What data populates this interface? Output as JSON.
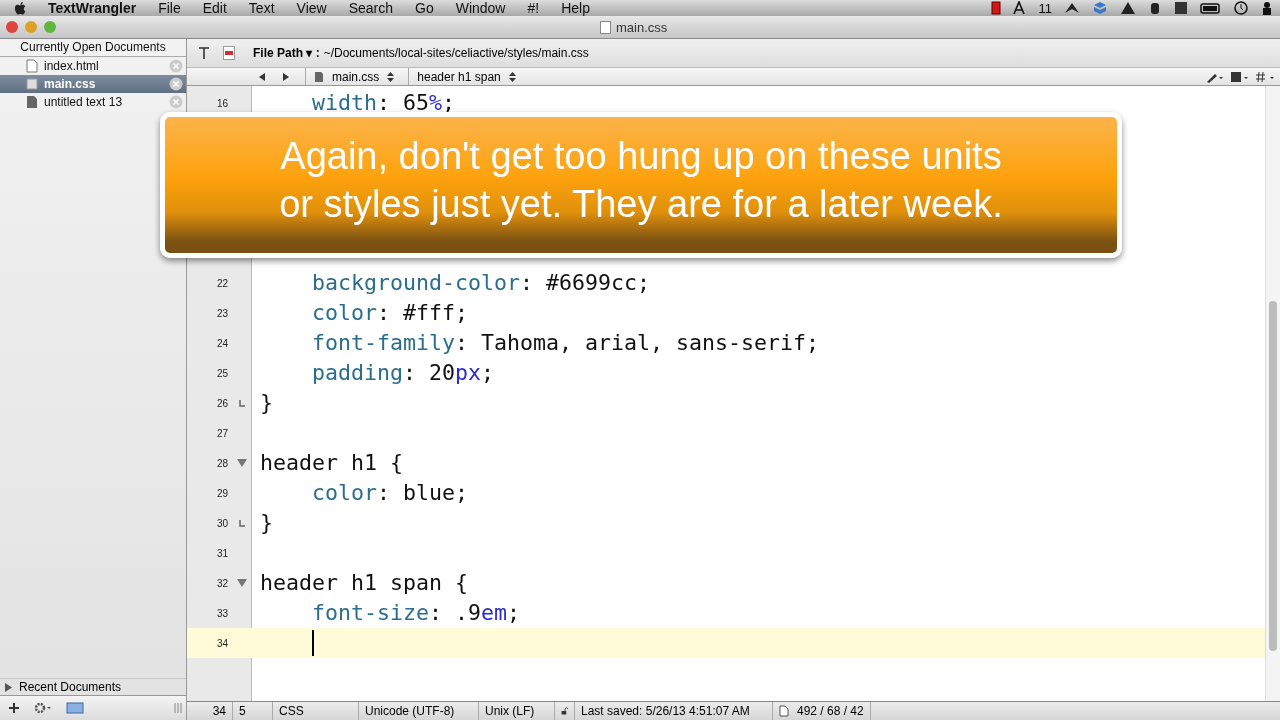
{
  "menu_bar": {
    "app_name": "TextWrangler",
    "items": [
      "File",
      "Edit",
      "Text",
      "View",
      "Search",
      "Go",
      "Window",
      "#!",
      "Help"
    ],
    "status_text": "11"
  },
  "window": {
    "title": "main.css"
  },
  "sidebar": {
    "header": "Currently Open Documents",
    "documents": [
      {
        "name": "index.html",
        "selected": false,
        "kind": "html"
      },
      {
        "name": "main.css",
        "selected": true,
        "kind": "css"
      },
      {
        "name": "untitled text 13",
        "selected": false,
        "kind": "text"
      }
    ],
    "recent": {
      "label": "Recent Documents",
      "expanded": false
    }
  },
  "toolbar": {
    "path_label": "File Path ▾ :",
    "path": "~/Documents/local-sites/celiactive/styles/main.css"
  },
  "navigation": {
    "document": "main.css",
    "symbol": "header h1 span"
  },
  "editor": {
    "lines": [
      {
        "number": "16",
        "fold_start": false,
        "fold_end": false,
        "indented": true,
        "current": false,
        "tokens": [
          {
            "kind": "prop",
            "text": "width"
          },
          {
            "kind": "plain",
            "text": ": 65"
          },
          {
            "kind": "unit",
            "text": "%"
          },
          {
            "kind": "plain",
            "text": ";"
          }
        ]
      },
      {
        "number": "22",
        "fold_start": false,
        "fold_end": false,
        "indented": true,
        "current": false,
        "tokens": [
          {
            "kind": "prop",
            "text": "background-color"
          },
          {
            "kind": "plain",
            "text": ": #6699cc;"
          }
        ]
      },
      {
        "number": "23",
        "fold_start": false,
        "fold_end": false,
        "indented": true,
        "current": false,
        "tokens": [
          {
            "kind": "prop",
            "text": "color"
          },
          {
            "kind": "plain",
            "text": ": #fff;"
          }
        ]
      },
      {
        "number": "24",
        "fold_start": false,
        "fold_end": false,
        "indented": true,
        "current": false,
        "tokens": [
          {
            "kind": "prop",
            "text": "font-family"
          },
          {
            "kind": "plain",
            "text": ": Tahoma, arial, sans-serif;"
          }
        ]
      },
      {
        "number": "25",
        "fold_start": false,
        "fold_end": false,
        "indented": true,
        "current": false,
        "tokens": [
          {
            "kind": "prop",
            "text": "padding"
          },
          {
            "kind": "plain",
            "text": ": 20"
          },
          {
            "kind": "unit",
            "text": "px"
          },
          {
            "kind": "plain",
            "text": ";"
          }
        ]
      },
      {
        "number": "26",
        "fold_start": false,
        "fold_end": true,
        "indented": false,
        "current": false,
        "tokens": [
          {
            "kind": "plain",
            "text": "}"
          }
        ]
      },
      {
        "number": "27",
        "fold_start": false,
        "fold_end": false,
        "current": false
      },
      {
        "number": "28",
        "fold_start": true,
        "fold_end": false,
        "indented": false,
        "current": false,
        "tokens": [
          {
            "kind": "plain",
            "text": "header h1 {"
          }
        ]
      },
      {
        "number": "29",
        "fold_start": false,
        "fold_end": false,
        "indented": true,
        "current": false,
        "tokens": [
          {
            "kind": "prop",
            "text": "color"
          },
          {
            "kind": "plain",
            "text": ": blue;"
          }
        ]
      },
      {
        "number": "30",
        "fold_start": false,
        "fold_end": true,
        "indented": false,
        "current": false,
        "tokens": [
          {
            "kind": "plain",
            "text": "}"
          }
        ]
      },
      {
        "number": "31",
        "fold_start": false,
        "fold_end": false,
        "current": false
      },
      {
        "number": "32",
        "fold_start": true,
        "fold_end": false,
        "indented": false,
        "current": false,
        "tokens": [
          {
            "kind": "plain",
            "text": "header h1 span {"
          }
        ]
      },
      {
        "number": "33",
        "fold_start": false,
        "fold_end": false,
        "indented": true,
        "current": false,
        "tokens": [
          {
            "kind": "prop",
            "text": "font-size"
          },
          {
            "kind": "plain",
            "text": ": .9"
          },
          {
            "kind": "unit",
            "text": "em"
          },
          {
            "kind": "plain",
            "text": ";"
          }
        ]
      },
      {
        "number": "34",
        "fold_start": false,
        "fold_end": false,
        "indented": true,
        "current": true
      }
    ]
  },
  "status_bar": {
    "line": "34",
    "column": "5",
    "language": "CSS",
    "encoding": "Unicode (UTF-8)",
    "line_endings": "Unix (LF)",
    "last_saved": "Last saved: 5/26/13 4:51:07 AM",
    "counts": "492 / 68 / 42"
  },
  "caption": {
    "lines": [
      "Again, don't get too hung up on these units",
      "or styles just yet. They are for a later week."
    ]
  }
}
